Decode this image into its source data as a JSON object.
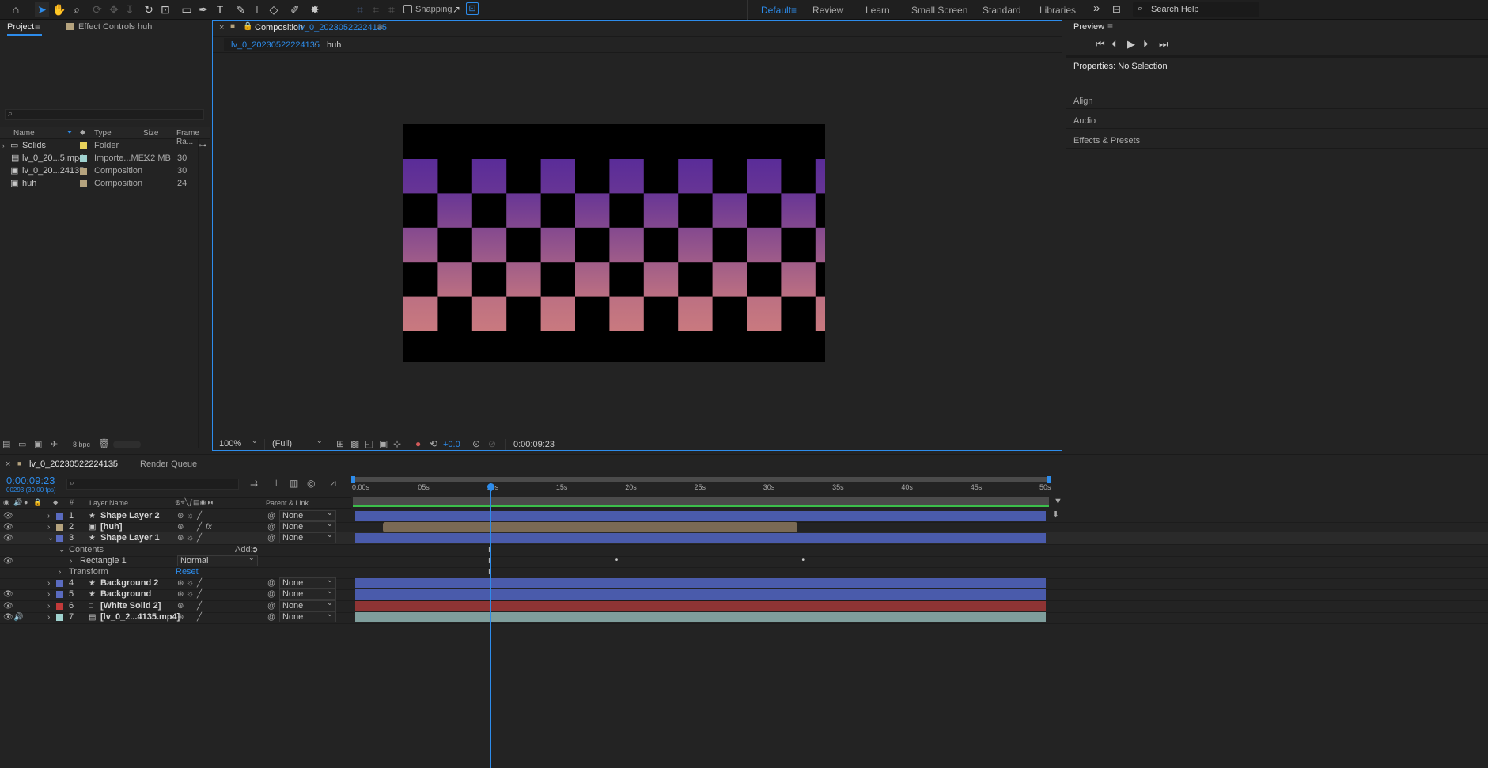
{
  "toolbar": {
    "snapping_label": "Snapping",
    "workspaces": [
      "Default",
      "Review",
      "Learn",
      "Small Screen",
      "Standard",
      "Libraries"
    ],
    "active_workspace": "Default",
    "search_placeholder": "Search Help"
  },
  "project": {
    "tab_project": "Project",
    "tab_effect_controls": "Effect Controls huh",
    "search_placeholder": "",
    "columns": [
      "Name",
      "Type",
      "Size",
      "Frame Ra..."
    ],
    "items": [
      {
        "name": "Solids",
        "type": "Folder",
        "size": "",
        "fps": "",
        "color": "#e8d25a"
      },
      {
        "name": "lv_0_20...5.mp4",
        "type": "Importe...MEX",
        "size": "1.2 MB",
        "fps": "30",
        "color": "#9fd2cf"
      },
      {
        "name": "lv_0_20...24135",
        "type": "Composition",
        "size": "",
        "fps": "30",
        "color": "#b5a37e"
      },
      {
        "name": "huh",
        "type": "Composition",
        "size": "",
        "fps": "24",
        "color": "#b5a37e"
      }
    ],
    "bpc": "8 bpc"
  },
  "composition": {
    "panel_label": "Composition",
    "name": "lv_0_20230522224135",
    "breadcrumb_active": "lv_0_20230522224135",
    "breadcrumb_next": "huh",
    "zoom": "100%",
    "resolution": "(Full)",
    "exposure": "+0.0",
    "timecode": "0:00:09:23",
    "colors": {
      "top": "#5a2c98",
      "bottom": "#c9797f"
    }
  },
  "right_panel": {
    "preview_title": "Preview",
    "properties": "Properties: No Selection",
    "sections": [
      "Align",
      "Audio",
      "Effects & Presets"
    ]
  },
  "timeline": {
    "comp_tab": "lv_0_20230522224135",
    "render_queue_tab": "Render Queue",
    "current_time": "0:00:09:23",
    "frame_info": "00293 (30.00 fps)",
    "search_placeholder": "",
    "col_num": "#",
    "col_layer_name": "Layer Name",
    "col_parent": "Parent & Link",
    "ruler": [
      "0:00s",
      "05s",
      "10s",
      "15s",
      "20s",
      "25s",
      "30s",
      "35s",
      "40s",
      "45s",
      "50s"
    ],
    "playhead_seconds": 9.77,
    "duration_seconds": 50,
    "layers": [
      {
        "num": "1",
        "name": "Shape Layer 2",
        "color": "#5a6bbf",
        "parent": "None",
        "icon": "★",
        "fx": false,
        "bar_color": "#4a5bab",
        "start": 0,
        "end": 50
      },
      {
        "num": "2",
        "name": "[huh]",
        "color": "#b5a37e",
        "parent": "None",
        "icon": "▣",
        "fx": true,
        "bar_color": "#7a6a55",
        "start": 2,
        "end": 32
      },
      {
        "num": "3",
        "name": "Shape Layer 1",
        "color": "#5a6bbf",
        "parent": "None",
        "icon": "★",
        "fx": false,
        "bar_color": "#4a5bab",
        "start": 0,
        "end": 50
      },
      {
        "num": "4",
        "name": "Background 2",
        "color": "#5a6bbf",
        "parent": "None",
        "icon": "★",
        "fx": false,
        "bar_color": "#4a5bab",
        "start": 0,
        "end": 50
      },
      {
        "num": "5",
        "name": "Background",
        "color": "#5a6bbf",
        "parent": "None",
        "icon": "★",
        "fx": false,
        "bar_color": "#4a5bab",
        "start": 0,
        "end": 50
      },
      {
        "num": "6",
        "name": "[White Solid 2]",
        "color": "#c23a3a",
        "parent": "None",
        "icon": "□",
        "fx": false,
        "bar_color": "#8e3434",
        "start": 0,
        "end": 50
      },
      {
        "num": "7",
        "name": "[lv_0_2...4135.mp4]",
        "color": "#9fd2cf",
        "parent": "None",
        "icon": "▤",
        "fx": false,
        "bar_color": "#7f9e9c",
        "start": 0,
        "end": 50
      }
    ],
    "contents_label": "Contents",
    "add_label": "Add:",
    "rectangle_label": "Rectangle 1",
    "blend_mode": "Normal",
    "transform_label": "Transform",
    "reset_label": "Reset",
    "keyframes_seconds": [
      19.0,
      32.5
    ]
  }
}
